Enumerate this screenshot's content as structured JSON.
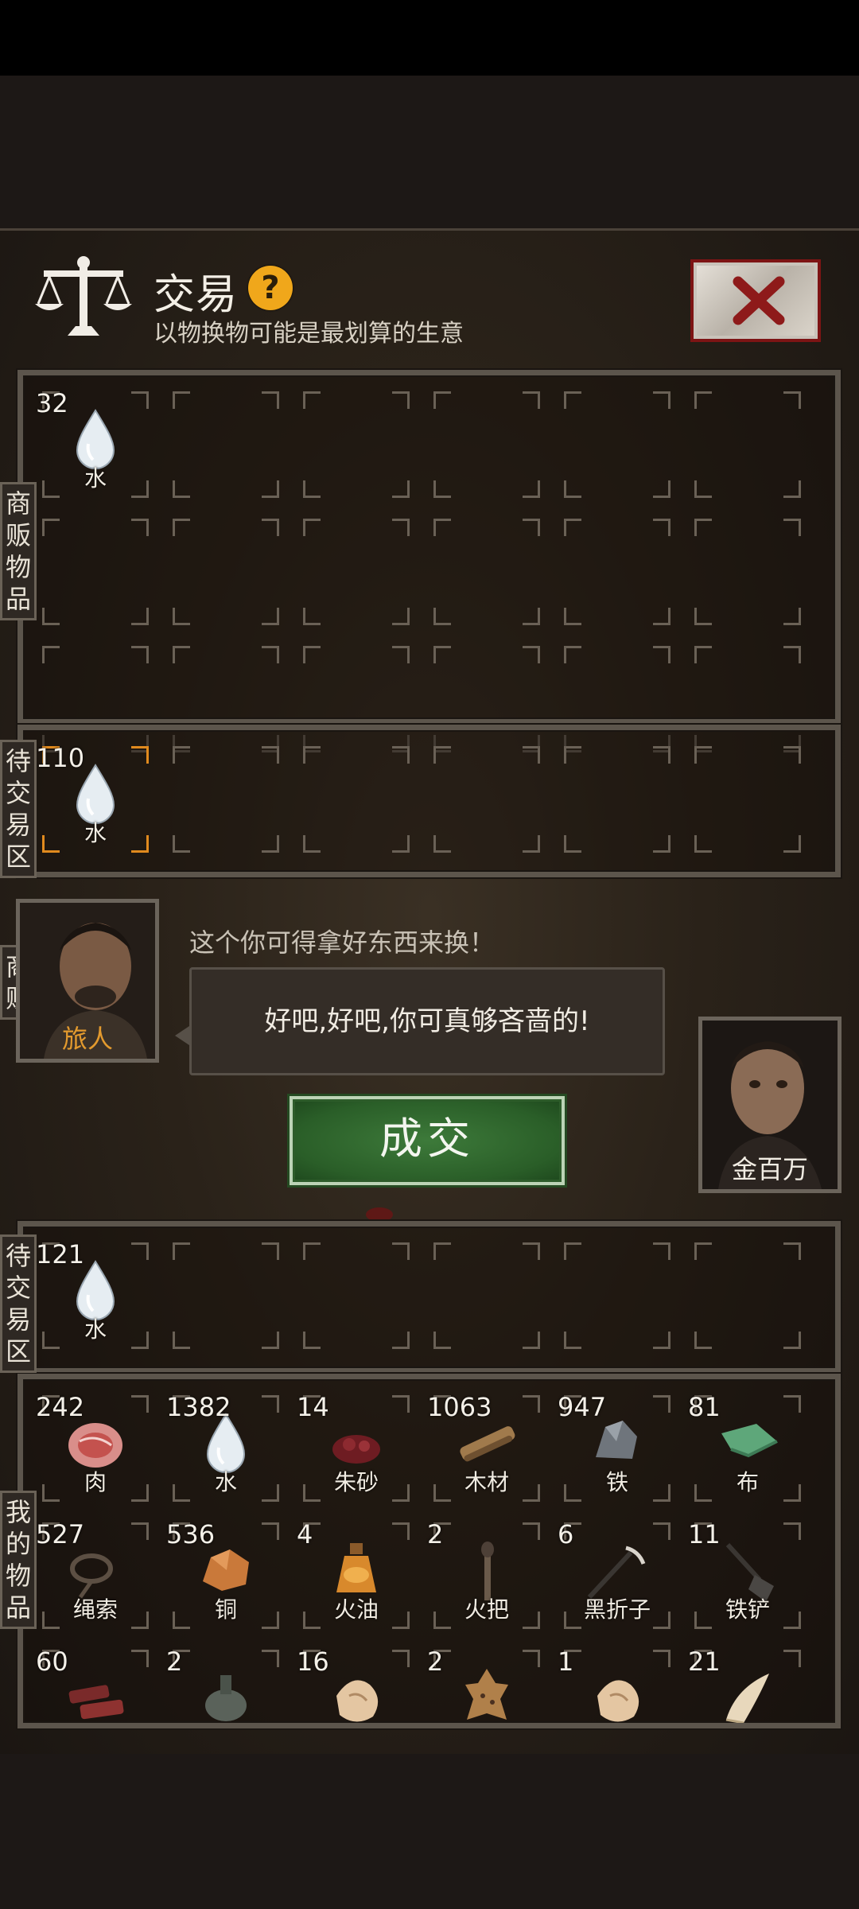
{
  "header": {
    "title": "交易",
    "help_icon": "?",
    "subtitle": "以物换物可能是最划算的生意",
    "close_icon": "close-x-icon"
  },
  "labels": {
    "merchant_items": [
      "商",
      "贩",
      "物",
      "品"
    ],
    "pending_top": [
      "待",
      "交",
      "易",
      "区"
    ],
    "merchant": [
      "商",
      "贩"
    ],
    "pending_bottom": [
      "待",
      "交",
      "易",
      "区"
    ],
    "my_items": [
      "我",
      "的",
      "物",
      "品"
    ]
  },
  "merchant_items": [
    {
      "count": "32",
      "name": "水",
      "icon": "water-drop-icon"
    }
  ],
  "pending_top": [
    {
      "count": "110",
      "name": "水",
      "icon": "water-drop-icon"
    }
  ],
  "merchant": {
    "name": "旅人",
    "line": "这个你可得拿好东西来换！",
    "reply": "好吧,好吧,你可真够吝啬的!"
  },
  "deal_button": "成交",
  "player": {
    "name": "金百万"
  },
  "pending_bottom": [
    {
      "count": "121",
      "name": "水",
      "icon": "water-drop-icon"
    }
  ],
  "my_items": [
    {
      "count": "242",
      "name": "肉",
      "icon": "meat-icon"
    },
    {
      "count": "1382",
      "name": "水",
      "icon": "water-drop-icon"
    },
    {
      "count": "14",
      "name": "朱砂",
      "icon": "cinnabar-icon"
    },
    {
      "count": "1063",
      "name": "木材",
      "icon": "wood-icon"
    },
    {
      "count": "947",
      "name": "铁",
      "icon": "iron-ore-icon"
    },
    {
      "count": "81",
      "name": "布",
      "icon": "cloth-icon"
    },
    {
      "count": "527",
      "name": "绳索",
      "icon": "rope-icon"
    },
    {
      "count": "536",
      "name": "铜",
      "icon": "copper-ore-icon"
    },
    {
      "count": "4",
      "name": "火油",
      "icon": "oil-bottle-icon"
    },
    {
      "count": "2",
      "name": "火把",
      "icon": "torch-icon"
    },
    {
      "count": "6",
      "name": "黑折子",
      "icon": "pickaxe-icon"
    },
    {
      "count": "11",
      "name": "铁铲",
      "icon": "shovel-icon"
    },
    {
      "count": "60",
      "name": "",
      "icon": "jerky-icon"
    },
    {
      "count": "2",
      "name": "",
      "icon": "flask-icon"
    },
    {
      "count": "16",
      "name": "",
      "icon": "bone-icon"
    },
    {
      "count": "2",
      "name": "",
      "icon": "hide-icon"
    },
    {
      "count": "1",
      "name": "",
      "icon": "bone-icon"
    },
    {
      "count": "21",
      "name": "",
      "icon": "fang-icon"
    }
  ]
}
